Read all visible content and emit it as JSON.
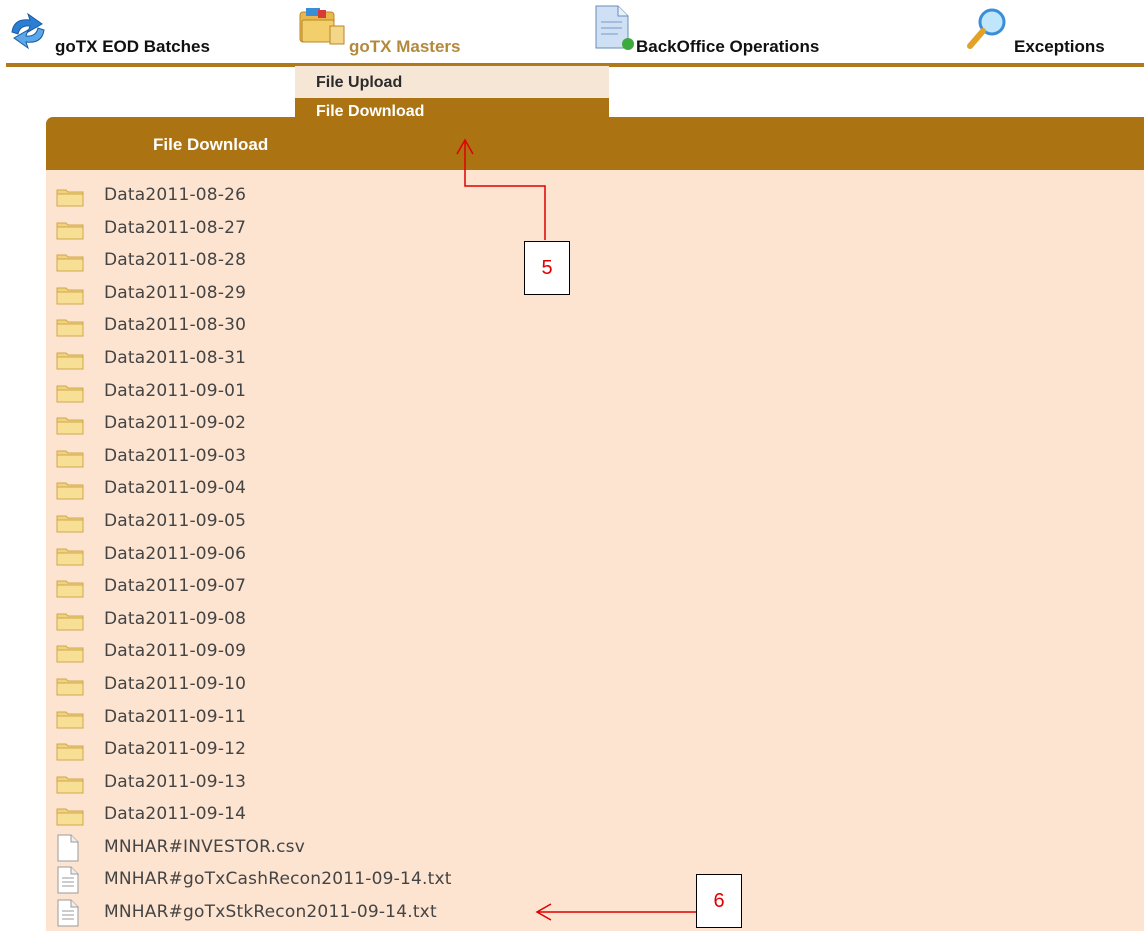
{
  "menu": {
    "items": [
      {
        "label": "goTX EOD Batches",
        "icon": "refresh-arrows-icon"
      },
      {
        "label": "goTX Masters",
        "icon": "masters-folder-icon"
      },
      {
        "label": "BackOffice Operations",
        "icon": "document-icon"
      },
      {
        "label": "Exceptions",
        "icon": "magnifier-icon"
      }
    ]
  },
  "dropdown": {
    "items": [
      {
        "label": "File Upload"
      },
      {
        "label": "File Download"
      }
    ]
  },
  "panel": {
    "title": "File Download"
  },
  "files": [
    {
      "name": "Data2011-08-26",
      "type": "folder"
    },
    {
      "name": "Data2011-08-27",
      "type": "folder"
    },
    {
      "name": "Data2011-08-28",
      "type": "folder"
    },
    {
      "name": "Data2011-08-29",
      "type": "folder"
    },
    {
      "name": "Data2011-08-30",
      "type": "folder"
    },
    {
      "name": "Data2011-08-31",
      "type": "folder"
    },
    {
      "name": "Data2011-09-01",
      "type": "folder"
    },
    {
      "name": "Data2011-09-02",
      "type": "folder"
    },
    {
      "name": "Data2011-09-03",
      "type": "folder"
    },
    {
      "name": "Data2011-09-04",
      "type": "folder"
    },
    {
      "name": "Data2011-09-05",
      "type": "folder"
    },
    {
      "name": "Data2011-09-06",
      "type": "folder"
    },
    {
      "name": "Data2011-09-07",
      "type": "folder"
    },
    {
      "name": "Data2011-09-08",
      "type": "folder"
    },
    {
      "name": "Data2011-09-09",
      "type": "folder"
    },
    {
      "name": "Data2011-09-10",
      "type": "folder"
    },
    {
      "name": "Data2011-09-11",
      "type": "folder"
    },
    {
      "name": "Data2011-09-12",
      "type": "folder"
    },
    {
      "name": "Data2011-09-13",
      "type": "folder"
    },
    {
      "name": "Data2011-09-14",
      "type": "folder"
    },
    {
      "name": "MNHAR#INVESTOR.csv",
      "type": "blank-file"
    },
    {
      "name": "MNHAR#goTxCashRecon2011-09-14.txt",
      "type": "text-file"
    },
    {
      "name": "MNHAR#goTxStkRecon2011-09-14.txt",
      "type": "text-file"
    }
  ],
  "annotations": [
    {
      "label": "5"
    },
    {
      "label": "6"
    }
  ],
  "colors": {
    "accent": "#ab7312",
    "panel_bg": "#fde4d1",
    "annotation": "#e00000"
  }
}
